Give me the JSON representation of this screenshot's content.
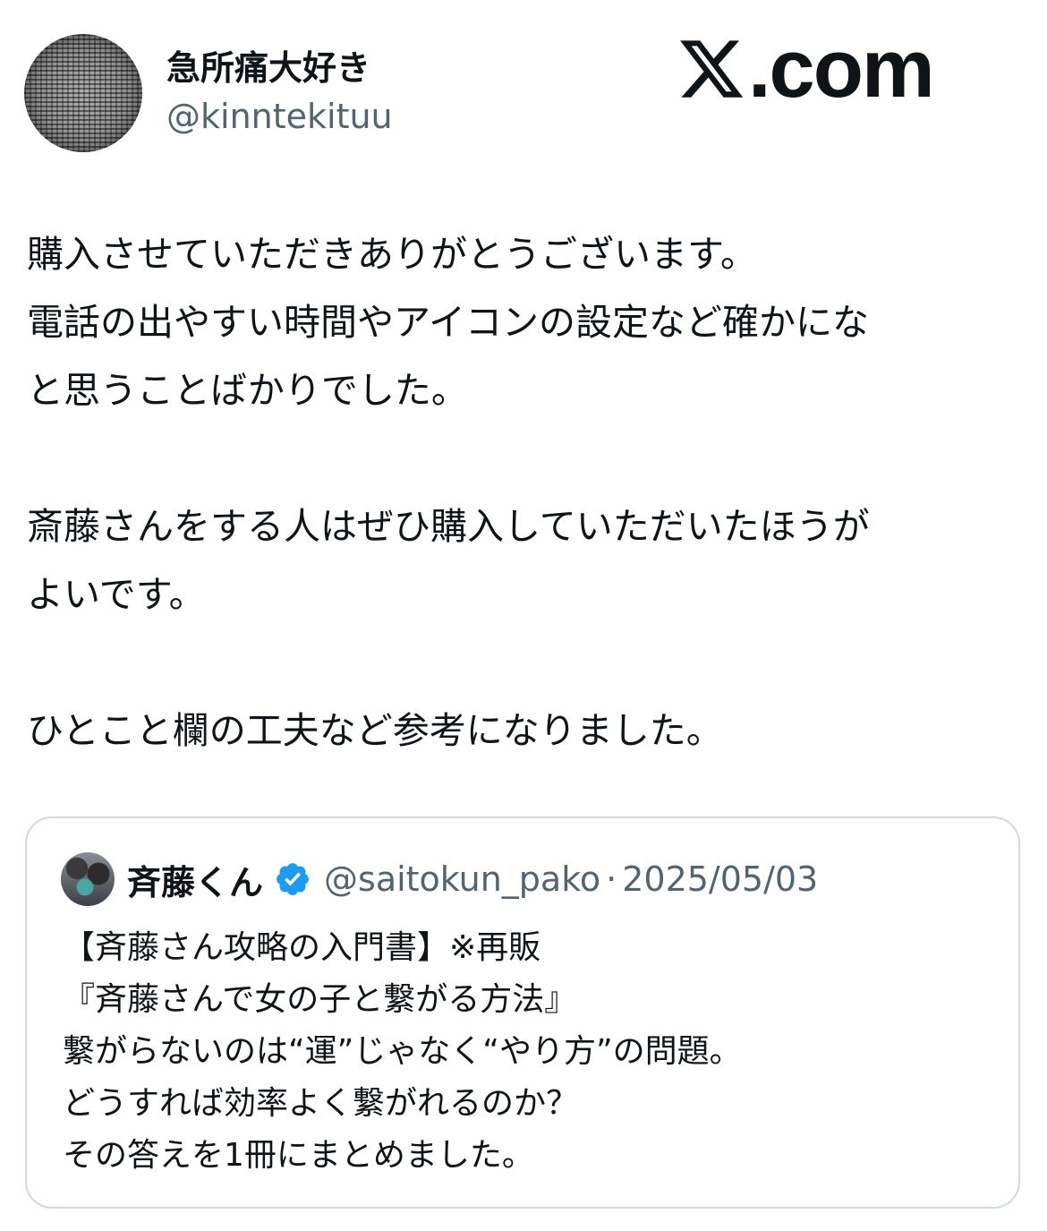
{
  "author": {
    "display_name": "急所痛大好き",
    "handle": "@kinntekituu"
  },
  "brand": {
    "x_icon": "x-logo-icon",
    "domain_text": ".com"
  },
  "tweet": {
    "paragraphs": [
      "購入させていただきありがとうございます。\n電話の出やすい時間やアイコンの設定など確かにな\nと思うことばかりでした。",
      "斎藤さんをする人はぜひ購入していただいたほうが\nよいです。",
      "ひとこと欄の工夫など参考になりました。"
    ]
  },
  "quoted_tweet": {
    "display_name": "斉藤くん",
    "verified_icon": "verified-badge-icon",
    "verified_color": "#1d9bf0",
    "handle": "@saitokun_pako",
    "separator": "·",
    "date": "2025/05/03",
    "lines": [
      "【斉藤さん攻略の入門書】※再販",
      "『斉藤さんで女の子と繋がる方法』",
      "繋がらないのは“運”じゃなく“やり方”の問題。",
      "どうすれば効率よく繋がれるのか？",
      "その答えを1冊にまとめました。"
    ]
  }
}
